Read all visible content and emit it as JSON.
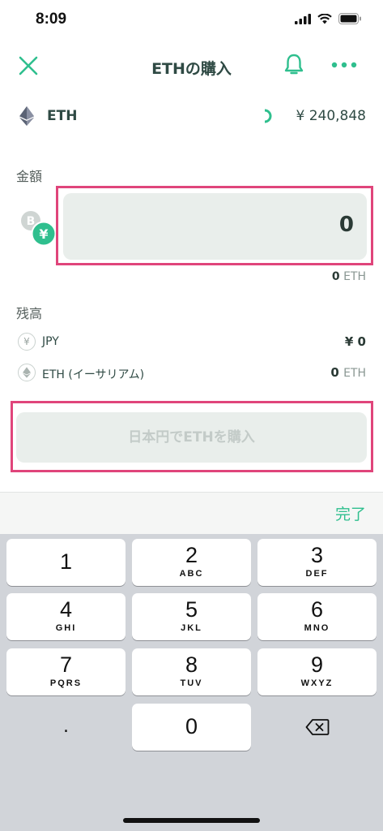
{
  "status_bar": {
    "time": "8:09"
  },
  "header": {
    "title": "ETHの購入"
  },
  "asset": {
    "name": "ETH",
    "price": "¥ 240,848"
  },
  "amount": {
    "label": "金額",
    "value": "0",
    "unit_value": "0",
    "unit": "ETH"
  },
  "balance": {
    "label": "残高",
    "rows": [
      {
        "icon": "¥",
        "label": "JPY",
        "value": "¥ 0",
        "unit": ""
      },
      {
        "icon": "◆",
        "label": "ETH (イーサリアム)",
        "value": "0",
        "unit": "ETH"
      }
    ]
  },
  "buy_button": {
    "label": "日本円でETHを購入"
  },
  "keyboard": {
    "done_label": "完了",
    "keys": [
      {
        "num": "1",
        "letters": ""
      },
      {
        "num": "2",
        "letters": "ABC"
      },
      {
        "num": "3",
        "letters": "DEF"
      },
      {
        "num": "4",
        "letters": "GHI"
      },
      {
        "num": "5",
        "letters": "JKL"
      },
      {
        "num": "6",
        "letters": "MNO"
      },
      {
        "num": "7",
        "letters": "PQRS"
      },
      {
        "num": "8",
        "letters": "TUV"
      },
      {
        "num": "9",
        "letters": "WXYZ"
      },
      {
        "num": "0",
        "letters": ""
      }
    ],
    "decimal": "."
  },
  "colors": {
    "accent": "#2fbf8e",
    "highlight": "#e0457b",
    "field_bg": "#e9eeeb"
  },
  "icons": [
    "close-icon",
    "bell-icon",
    "more-icon",
    "eth-logo-icon",
    "spinner-icon",
    "bitcoin-icon",
    "yen-icon",
    "backspace-icon"
  ]
}
